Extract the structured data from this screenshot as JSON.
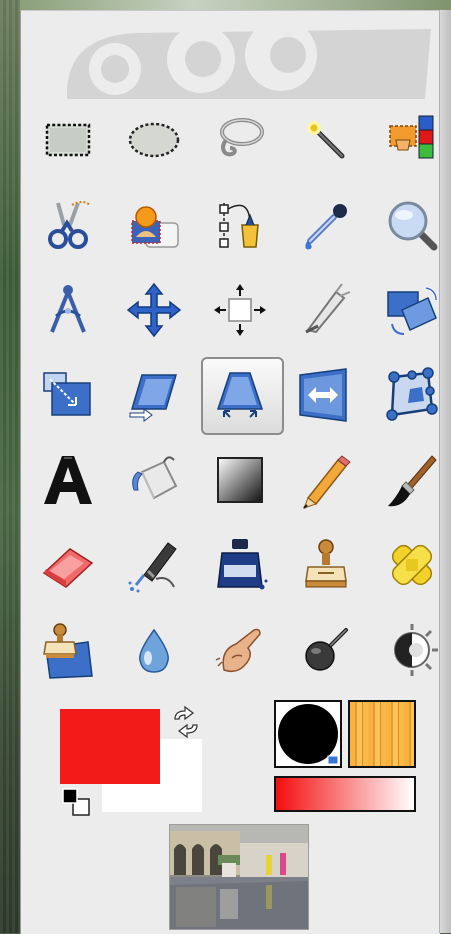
{
  "toolbox": {
    "accent_colors": {
      "foreground": "#f31a1a",
      "background": "#ffffff",
      "active_tool_border": "#8d8d8d"
    },
    "tools": [
      {
        "icon": "rect-select-icon"
      },
      {
        "icon": "ellipse-select-icon"
      },
      {
        "icon": "free-select-lasso-icon"
      },
      {
        "icon": "fuzzy-select-wand-icon"
      },
      {
        "icon": "select-by-color-icon"
      },
      {
        "icon": "scissors-select-icon"
      },
      {
        "icon": "foreground-select-icon"
      },
      {
        "icon": "paths-tool-icon"
      },
      {
        "icon": "color-picker-icon"
      },
      {
        "icon": "zoom-icon"
      },
      {
        "icon": "measure-icon"
      },
      {
        "icon": "move-icon"
      },
      {
        "icon": "alignment-icon"
      },
      {
        "icon": "crop-icon"
      },
      {
        "icon": "rotate-icon"
      },
      {
        "icon": "scale-icon"
      },
      {
        "icon": "shear-icon"
      },
      {
        "icon": "perspective-icon",
        "active": true
      },
      {
        "icon": "flip-icon"
      },
      {
        "icon": "cage-transform-icon"
      },
      {
        "icon": "text-tool-icon"
      },
      {
        "icon": "bucket-fill-icon"
      },
      {
        "icon": "blend-gradient-icon"
      },
      {
        "icon": "pencil-icon"
      },
      {
        "icon": "paintbrush-icon"
      },
      {
        "icon": "eraser-icon"
      },
      {
        "icon": "airbrush-icon"
      },
      {
        "icon": "ink-icon"
      },
      {
        "icon": "clone-stamp-icon"
      },
      {
        "icon": "heal-icon"
      },
      {
        "icon": "perspective-clone-icon"
      },
      {
        "icon": "blur-sharpen-icon"
      },
      {
        "icon": "smudge-icon"
      },
      {
        "icon": "dodge-burn-icon"
      },
      {
        "icon": "color-tool-icon"
      }
    ]
  }
}
